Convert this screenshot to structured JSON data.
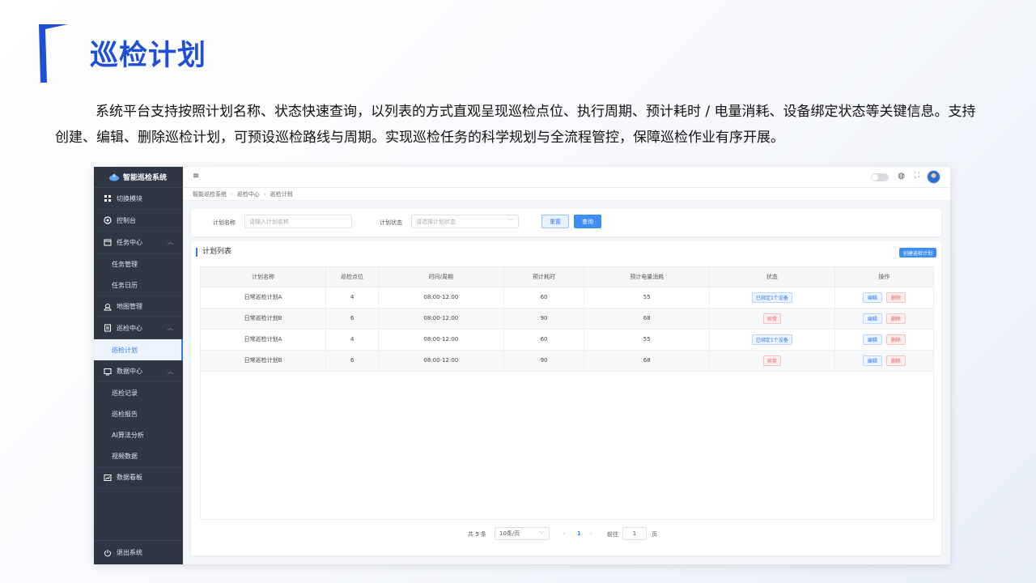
{
  "slide": {
    "title": "巡检计划",
    "description": "系统平台支持按照计划名称、状态快速查询，以列表的方式直观呈现巡检点位、执行周期、预计耗时 / 电量消耗、设备绑定状态等关键信息。支持创建、编辑、删除巡检计划，可预设巡检路线与周期。实现巡检任务的科学规划与全流程管控，保障巡检作业有序开展。",
    "accent_color": "#1f4fd6"
  },
  "app": {
    "logo_text": "智能巡检系统",
    "sidebar": {
      "switch_module": "切换模块",
      "dashboard": "控制台",
      "task_center": "任务中心",
      "task_manage": "任务管理",
      "task_calendar": "任务日历",
      "map_manage": "地图管理",
      "patrol_center": "巡检中心",
      "patrol_plan": "巡检计划",
      "data_center": "数据中心",
      "patrol_record": "巡检记录",
      "patrol_report": "巡检报告",
      "ai_analysis": "AI算法分析",
      "video_data": "视频数据",
      "data_board": "数据看板",
      "exit": "退出系统"
    },
    "breadcrumb": [
      "智能巡检系统",
      "巡检中心",
      "巡检计划"
    ],
    "search": {
      "name_label": "计划名称",
      "name_placeholder": "请输入计划名称",
      "status_label": "计划状态",
      "status_placeholder": "请选择计划状态",
      "reset": "重置",
      "query": "查询"
    },
    "list": {
      "title": "计划列表",
      "create": "创建巡检计划",
      "headers": [
        "计划名称",
        "巡检点位",
        "时间/周期",
        "预计耗时",
        "预计电量消耗",
        "状态",
        "操作"
      ],
      "rows": [
        {
          "name": "日常巡检计划A",
          "points": "4",
          "period": "08:00-12:00",
          "time": "60",
          "power": "55",
          "status": "已绑定1个设备",
          "status_type": "bound"
        },
        {
          "name": "日常巡检计划B",
          "points": "6",
          "period": "08:00-12:00",
          "time": "90",
          "power": "68",
          "status": "异常",
          "status_type": "abnormal"
        },
        {
          "name": "日常巡检计划A",
          "points": "4",
          "period": "08:00-12:00",
          "time": "60",
          "power": "55",
          "status": "已绑定1个设备",
          "status_type": "bound"
        },
        {
          "name": "日常巡检计划B",
          "points": "6",
          "period": "08:00-12:00",
          "time": "90",
          "power": "68",
          "status": "异常",
          "status_type": "abnormal"
        }
      ],
      "edit": "编辑",
      "delete": "删除"
    },
    "pagination": {
      "total": "共 5 条",
      "page_size": "10条/页",
      "current": "1",
      "goto_label": "前往",
      "goto_value": "1",
      "page_unit": "页"
    }
  }
}
